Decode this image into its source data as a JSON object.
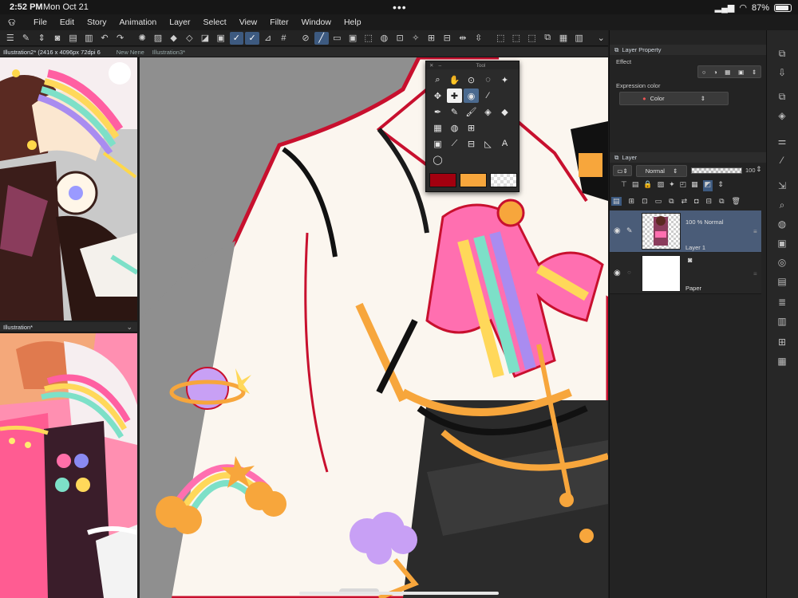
{
  "status_bar": {
    "time": "2:52 PM",
    "date": "Mon Oct 21",
    "battery": "87%",
    "battery_level": 0.87
  },
  "menu": [
    "File",
    "Edit",
    "Story",
    "Animation",
    "Layer",
    "Select",
    "View",
    "Filter",
    "Window",
    "Help"
  ],
  "tabs_top": [
    {
      "label": "Illustration2* (2416 x 4096px 72dpi 6",
      "active": true
    },
    {
      "label": "New Nene",
      "active": false
    },
    {
      "label": "Illustration3*",
      "active": false
    }
  ],
  "tab_lower": {
    "label": "Illustration*"
  },
  "tool_palette": {
    "title": "Tool",
    "colors": {
      "main": "#a3000f",
      "sub": "#f7a63c"
    }
  },
  "layer_property": {
    "title": "Layer Property",
    "effect_label": "Effect",
    "expression_label": "Expression color",
    "expression_value": "Color"
  },
  "layer_panel": {
    "title": "Layer",
    "blend_mode": "Normal",
    "opacity": "100",
    "layers": [
      {
        "info": "100 % Normal",
        "name": "Layer 1",
        "selected": true
      },
      {
        "info": "",
        "name": "Paper",
        "selected": false
      }
    ]
  },
  "colors": {
    "selection": "#4a5c78",
    "accent": "#3d5a80",
    "canvas_bg": "#8f8f8f"
  }
}
